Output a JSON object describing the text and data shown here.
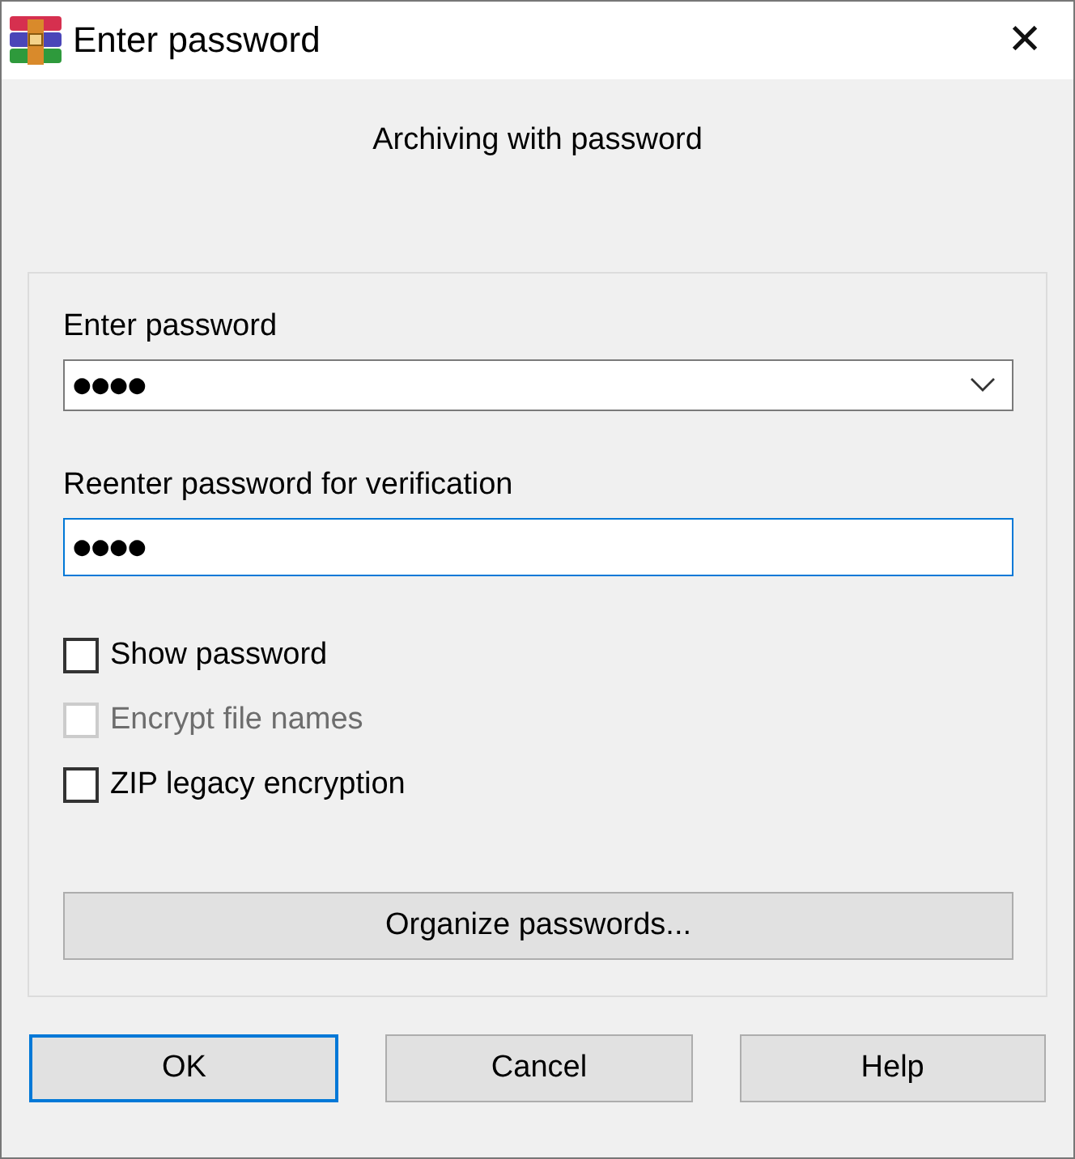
{
  "window": {
    "title": "Enter password",
    "close": "✕"
  },
  "subtitle": "Archiving with password",
  "fields": [
    {
      "kind": "combo",
      "label": "Enter password",
      "value": "●●●●",
      "focused": false
    },
    {
      "kind": "text",
      "label": "Reenter password for verification",
      "value": "●●●●",
      "focused": true
    }
  ],
  "checkboxes": [
    {
      "label": "Show password",
      "checked": false,
      "disabled": false
    },
    {
      "label": "Encrypt file names",
      "checked": false,
      "disabled": true
    },
    {
      "label": "ZIP legacy encryption",
      "checked": false,
      "disabled": false
    }
  ],
  "organize_button": "Organize passwords...",
  "buttons": [
    {
      "label": "OK",
      "default": true
    },
    {
      "label": "Cancel",
      "default": false
    },
    {
      "label": "Help",
      "default": false
    }
  ]
}
